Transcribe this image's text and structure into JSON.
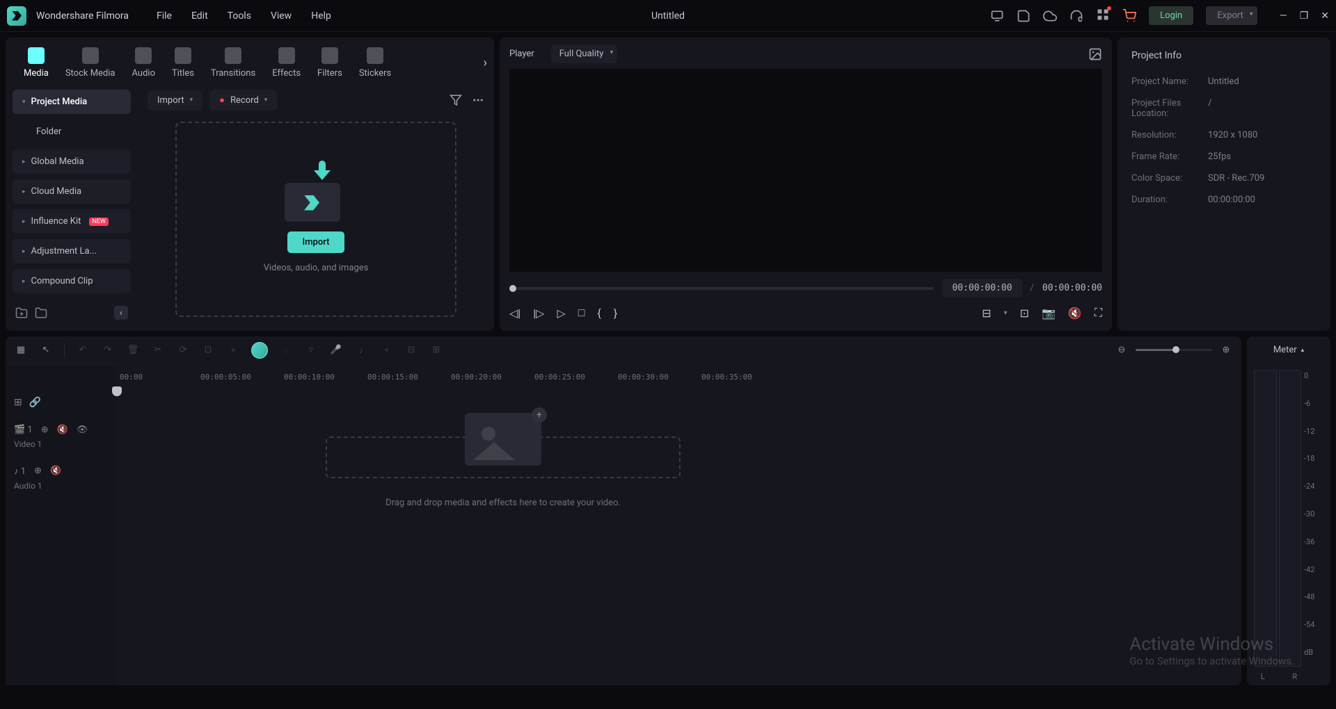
{
  "app": {
    "name": "Wondershare Filmora",
    "title": "Untitled"
  },
  "menus": [
    "File",
    "Edit",
    "Tools",
    "View",
    "Help"
  ],
  "titlebar": {
    "login": "Login",
    "export": "Export"
  },
  "tabs": [
    {
      "label": "Media"
    },
    {
      "label": "Stock Media"
    },
    {
      "label": "Audio"
    },
    {
      "label": "Titles"
    },
    {
      "label": "Transitions"
    },
    {
      "label": "Effects"
    },
    {
      "label": "Filters"
    },
    {
      "label": "Stickers"
    }
  ],
  "sidebar": {
    "items": [
      {
        "label": "Project Media"
      },
      {
        "label": "Folder"
      },
      {
        "label": "Global Media"
      },
      {
        "label": "Cloud Media"
      },
      {
        "label": "Influence Kit",
        "badge": "NEW"
      },
      {
        "label": "Adjustment La..."
      },
      {
        "label": "Compound Clip"
      }
    ]
  },
  "mediaToolbar": {
    "import": "Import",
    "record": "Record"
  },
  "importZone": {
    "action": "Import",
    "hint": "Videos, audio, and images"
  },
  "preview": {
    "player_label": "Player",
    "quality": "Full Quality",
    "current": "00:00:00:00",
    "duration": "00:00:00:00"
  },
  "info": {
    "title": "Project Info",
    "rows": [
      {
        "k": "Project Name:",
        "v": "Untitled"
      },
      {
        "k": "Project Files Location:",
        "v": "/"
      },
      {
        "k": "Resolution:",
        "v": "1920 x 1080"
      },
      {
        "k": "Frame Rate:",
        "v": "25fps"
      },
      {
        "k": "Color Space:",
        "v": "SDR - Rec.709"
      },
      {
        "k": "Duration:",
        "v": "00:00:00:00"
      }
    ]
  },
  "timeline": {
    "ruler": [
      "00:00",
      "00:00:05:00",
      "00:00:10:00",
      "00:00:15:00",
      "00:00:20:00",
      "00:00:25:00",
      "00:00:30:00",
      "00:00:35:00"
    ],
    "tracks": [
      {
        "name": "Video 1"
      },
      {
        "name": "Audio 1"
      }
    ],
    "dropHint": "Drag and drop media and effects here to create your video."
  },
  "meter": {
    "title": "Meter",
    "scale": [
      "0",
      "-6",
      "-12",
      "-18",
      "-24",
      "-30",
      "-36",
      "-42",
      "-48",
      "-54",
      "dB"
    ],
    "channels": [
      "L",
      "R"
    ]
  },
  "watermark": {
    "title": "Activate Windows",
    "sub": "Go to Settings to activate Windows."
  }
}
